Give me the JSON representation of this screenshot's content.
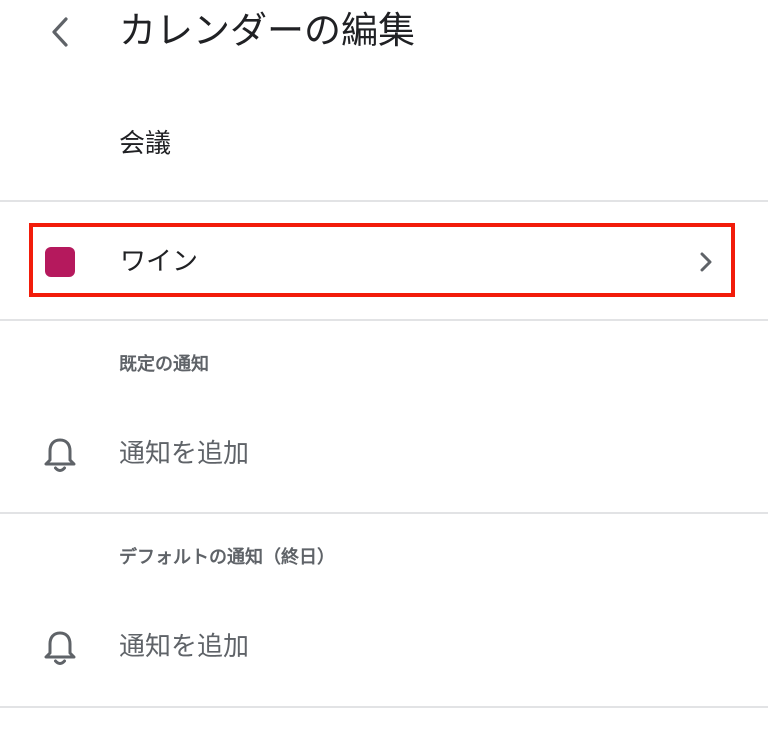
{
  "header": {
    "title": "カレンダーの編集",
    "back_icon": "chevron-left-icon"
  },
  "calendar": {
    "name": "会議"
  },
  "color": {
    "label": "ワイン",
    "swatch_color": "#b5195d",
    "highlight_color": "#f21c0a",
    "chevron_icon": "chevron-right-icon"
  },
  "default_notifications": {
    "header": "既定の通知",
    "add_label": "通知を追加",
    "icon": "bell-icon"
  },
  "allday_notifications": {
    "header": "デフォルトの通知（終日）",
    "add_label": "通知を追加",
    "icon": "bell-icon"
  }
}
